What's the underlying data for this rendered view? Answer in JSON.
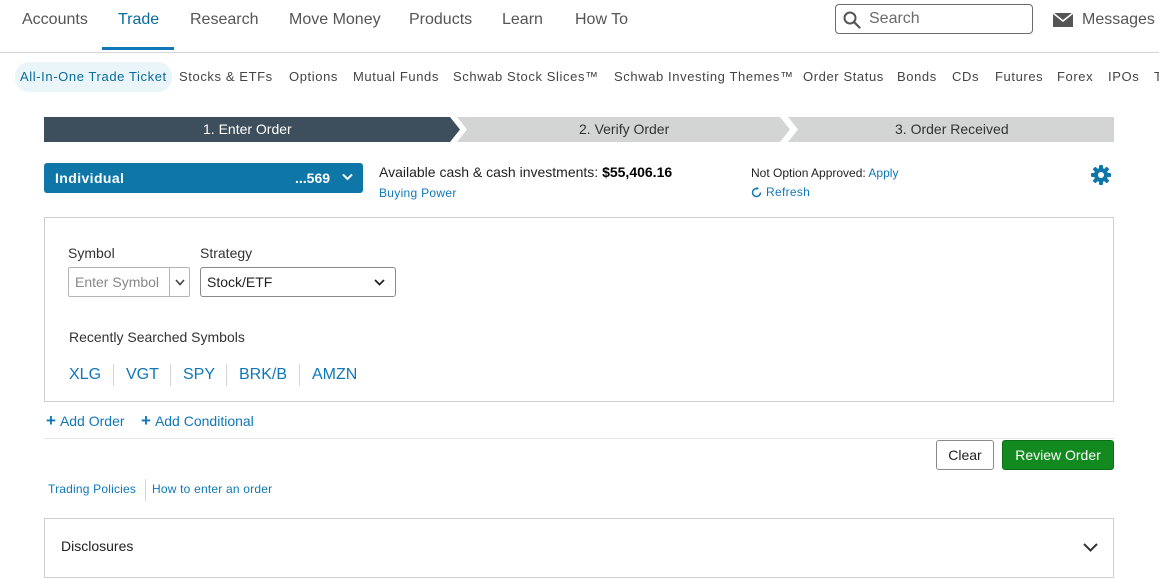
{
  "top_nav": {
    "items": [
      "Accounts",
      "Trade",
      "Research",
      "Move Money",
      "Products",
      "Learn",
      "How To"
    ],
    "active": "Trade",
    "search_placeholder": "Search",
    "messages_label": "Messages"
  },
  "sub_nav": {
    "items": [
      "All-In-One Trade Ticket",
      "Stocks & ETFs",
      "Options",
      "Mutual Funds",
      "Schwab Stock Slices™",
      "Schwab Investing Themes™",
      "Order Status",
      "Bonds",
      "CDs",
      "Futures",
      "Forex",
      "IPOs",
      "T"
    ],
    "active": "All-In-One Trade Ticket"
  },
  "steps": [
    "1. Enter Order",
    "2. Verify Order",
    "3. Order Received"
  ],
  "account": {
    "name": "Individual",
    "number": "...569",
    "cash_label": "Available cash & cash investments:",
    "cash_value": "$55,406.16",
    "buying_power_link": "Buying Power",
    "option_status": "Not Option Approved:",
    "apply_link": "Apply",
    "refresh_link": "Refresh"
  },
  "order": {
    "symbol_label": "Symbol",
    "symbol_placeholder": "Enter Symbol",
    "strategy_label": "Strategy",
    "strategy_value": "Stock/ETF",
    "recent_label": "Recently Searched Symbols",
    "recent_symbols": [
      "XLG",
      "VGT",
      "SPY",
      "BRK/B",
      "AMZN"
    ]
  },
  "actions": {
    "add_order": "Add Order",
    "add_conditional": "Add Conditional",
    "clear": "Clear",
    "review": "Review Order"
  },
  "footer_links": {
    "trading_policies": "Trading Policies",
    "how_to": "How to enter an order"
  },
  "disclosures": {
    "title": "Disclosures"
  },
  "colors": {
    "brand_blue": "#0f77a8",
    "link_blue": "#1077b8",
    "step_active": "#3d4f5c",
    "step_inactive": "#d3d5d5",
    "review_green": "#128a1f"
  }
}
